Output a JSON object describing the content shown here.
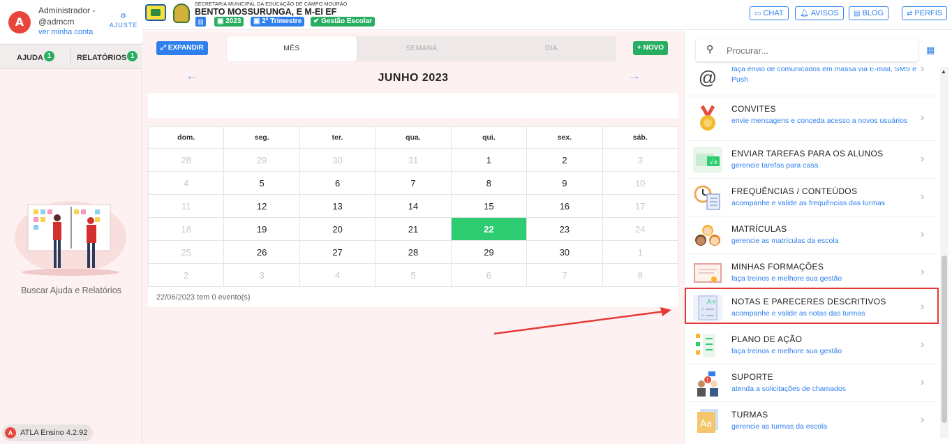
{
  "profile": {
    "name": "Administrador -",
    "login": "@admcm",
    "link": "ver minha conta",
    "ajuste": "AJUSTE",
    "logo": "A"
  },
  "help_tabs": [
    {
      "label": "AJUDA",
      "badge": "1"
    },
    {
      "label": "RELATÓRIOS",
      "badge": "1"
    }
  ],
  "help_caption": "Buscar Ajuda e Relatórios",
  "version": "ATLA Ensino 4.2.92",
  "header": {
    "secretaria": "SECRETARIA MUNICIPAL DA EDUCAÇÃO DE CAMPO MOURÃO",
    "school": "BENTO MOSSURUNGA, E M-EI EF",
    "chips": [
      "2023",
      "2º Trimestre",
      "Gestão Escolar"
    ],
    "buttons": {
      "chat": "CHAT",
      "avisos": "AVISOS",
      "blog": "BLOG",
      "perfis": "PERFIS"
    }
  },
  "calendar": {
    "expand": "EXPANDIR",
    "new": "NOVO",
    "views": [
      "MÊS",
      "SEMANA",
      "DIA"
    ],
    "active_view": "MÊS",
    "month": "JUNHO 2023",
    "weekdays": [
      "dom.",
      "seg.",
      "ter.",
      "qua.",
      "qui.",
      "sex.",
      "sáb."
    ],
    "weeks": [
      [
        "28",
        "29",
        "30",
        "31",
        "1",
        "2",
        "3"
      ],
      [
        "4",
        "5",
        "6",
        "7",
        "8",
        "9",
        "10"
      ],
      [
        "11",
        "12",
        "13",
        "14",
        "15",
        "16",
        "17"
      ],
      [
        "18",
        "19",
        "20",
        "21",
        "22",
        "23",
        "24"
      ],
      [
        "25",
        "26",
        "27",
        "28",
        "29",
        "30",
        "1"
      ],
      [
        "2",
        "3",
        "4",
        "5",
        "6",
        "7",
        "8"
      ]
    ],
    "today": "22",
    "events_line": "22/06/2023 tem 0 evento(s)"
  },
  "search": {
    "placeholder": "Procurar..."
  },
  "menu": [
    {
      "title": "",
      "subtitle": "faça envio de comunicados em massa via E-mail, SMS e Push",
      "icon": "at-sign-icon"
    },
    {
      "title": "CONVITES",
      "subtitle": "envie mensagens e conceda acesso a novos usuários",
      "icon": "medal-icon"
    },
    {
      "title": "ENVIAR TAREFAS PARA OS ALUNOS",
      "subtitle": "gerencie tarefas para casa",
      "icon": "tasks-icon"
    },
    {
      "title": "FREQUÊNCIAS / CONTEÚDOS",
      "subtitle": "acompanhe e valide as frequências das turmas",
      "icon": "clock-checklist-icon"
    },
    {
      "title": "MATRÍCULAS",
      "subtitle": "gerencie as matrículas da escola",
      "icon": "students-icon"
    },
    {
      "title": "MINHAS FORMAÇÕES",
      "subtitle": "faça treinos e melhore sua gestão",
      "icon": "certificate-icon"
    },
    {
      "title": "NOTAS E PARECERES DESCRITIVOS",
      "subtitle": "acompanhe e valide as notas das turmas",
      "icon": "grades-icon"
    },
    {
      "title": "PLANO DE AÇÃO",
      "subtitle": "faça treinos e melhore sua gestão",
      "icon": "action-plan-icon"
    },
    {
      "title": "SUPORTE",
      "subtitle": "atenda a solicitações de chamados",
      "icon": "support-icon"
    },
    {
      "title": "TURMAS",
      "subtitle": "gerencie as turmas da escola",
      "icon": "classes-icon"
    }
  ],
  "colors": {
    "accent": "#2f80ed",
    "green": "#27ae60",
    "today": "#2ecc71",
    "brand_red": "#e8453c",
    "highlight_border": "#e53935"
  }
}
